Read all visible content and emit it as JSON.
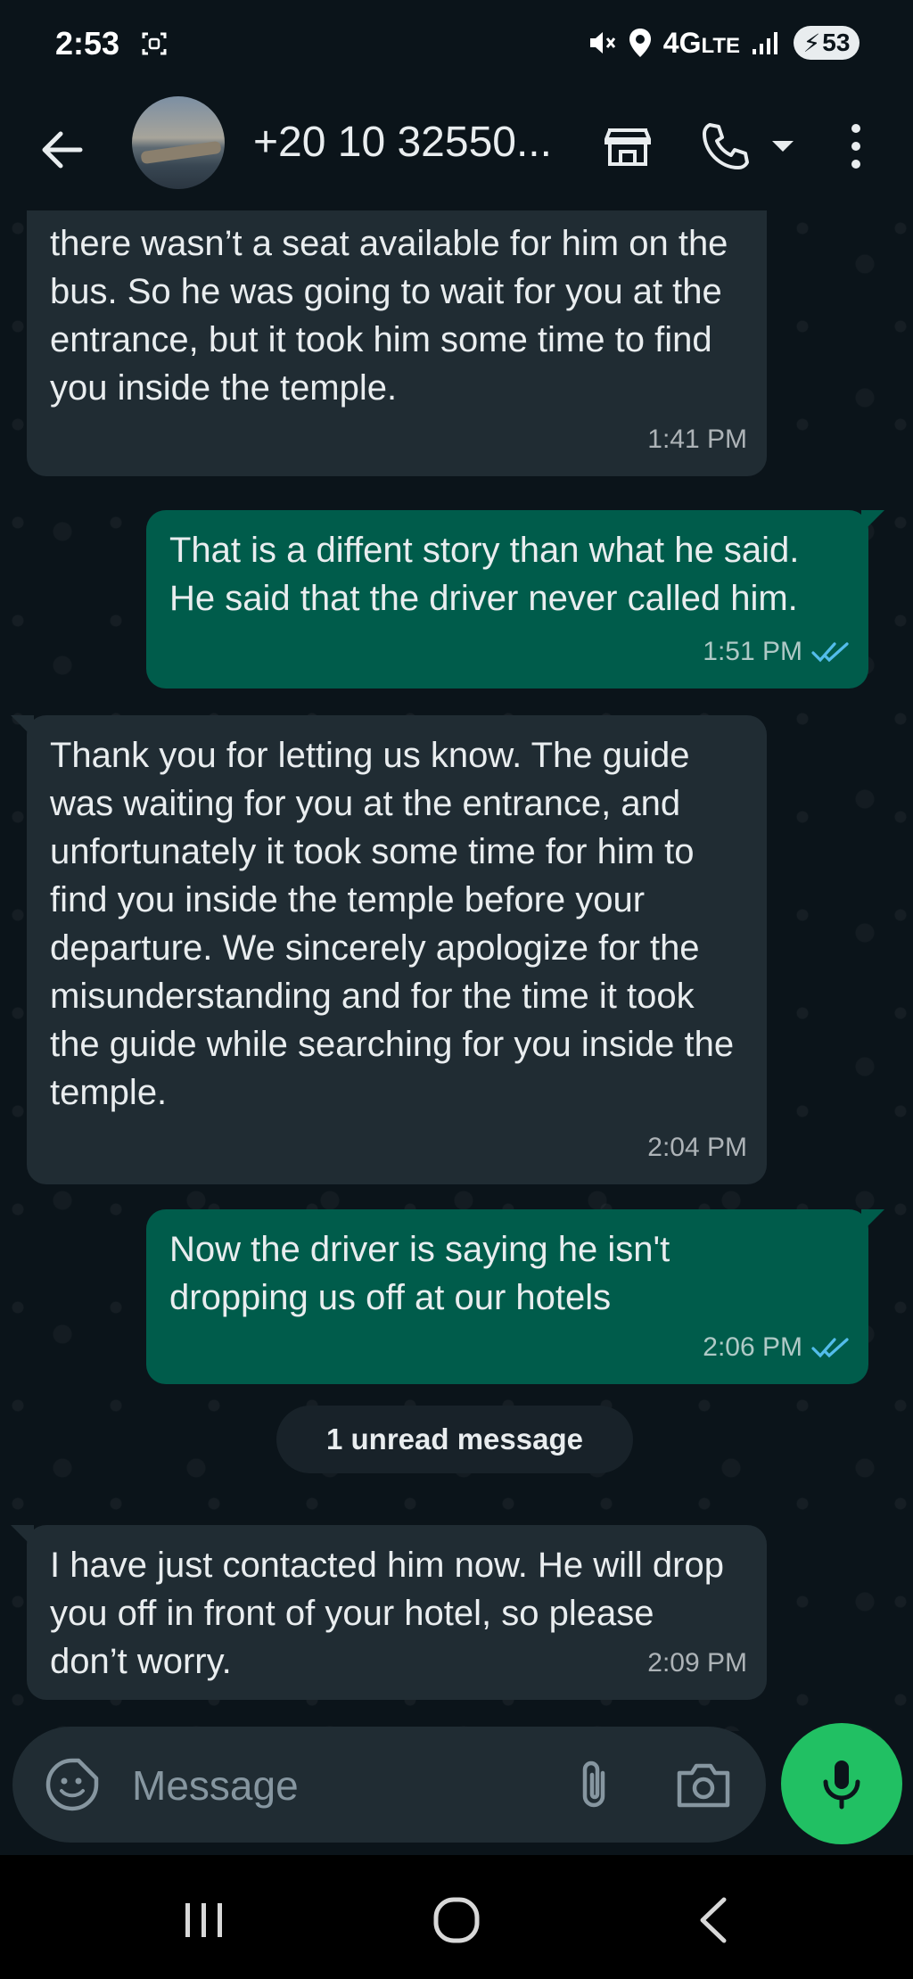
{
  "status_bar": {
    "time": "2:53",
    "network": "4G",
    "network_sub": "LTE",
    "battery": "53"
  },
  "header": {
    "contact_name": "+20 10 32550..."
  },
  "messages": [
    {
      "direction": "incoming",
      "partial": true,
      "text": "there wasn’t a seat available for him on the bus. So he was going to wait for you at the entrance, but it took him some time to find you inside the temple.",
      "time": "1:41 PM"
    },
    {
      "direction": "outgoing",
      "text": "That is a diffent story than what he said. He said that the driver never called him.",
      "time": "1:51 PM",
      "status": "read"
    },
    {
      "direction": "incoming",
      "text": "Thank you for letting us know. The guide was waiting for you at the entrance, and unfortunately it took some time for him to find you inside the temple before your departure. We sincerely apologize for the misunderstanding and for the time it took the guide while searching for you inside the temple.",
      "time": "2:04 PM"
    },
    {
      "direction": "outgoing",
      "text": "Now the driver is saying he isn't dropping us off at our hotels",
      "time": "2:06 PM",
      "status": "read"
    },
    {
      "direction": "incoming",
      "text": "I have just contacted him now. He will drop you off in front of your hotel, so please don’t worry.",
      "time": "2:09 PM"
    }
  ],
  "unread_divider": "1 unread message",
  "composer": {
    "placeholder": "Message"
  },
  "colors": {
    "background": "#0b141a",
    "incoming_bubble": "#202c33",
    "outgoing_bubble": "#005c4b",
    "read_tick": "#53bdeb",
    "mic_button": "#21c063"
  },
  "icons": {
    "back": "arrow-left-icon",
    "store": "store-icon",
    "call": "phone-icon",
    "call_dropdown": "chevron-down-icon",
    "menu": "more-vert-icon",
    "emoji": "sticker-emoji-icon",
    "attach": "paperclip-icon",
    "camera": "camera-icon",
    "mic": "mic-icon",
    "read_receipt": "double-check-icon"
  }
}
